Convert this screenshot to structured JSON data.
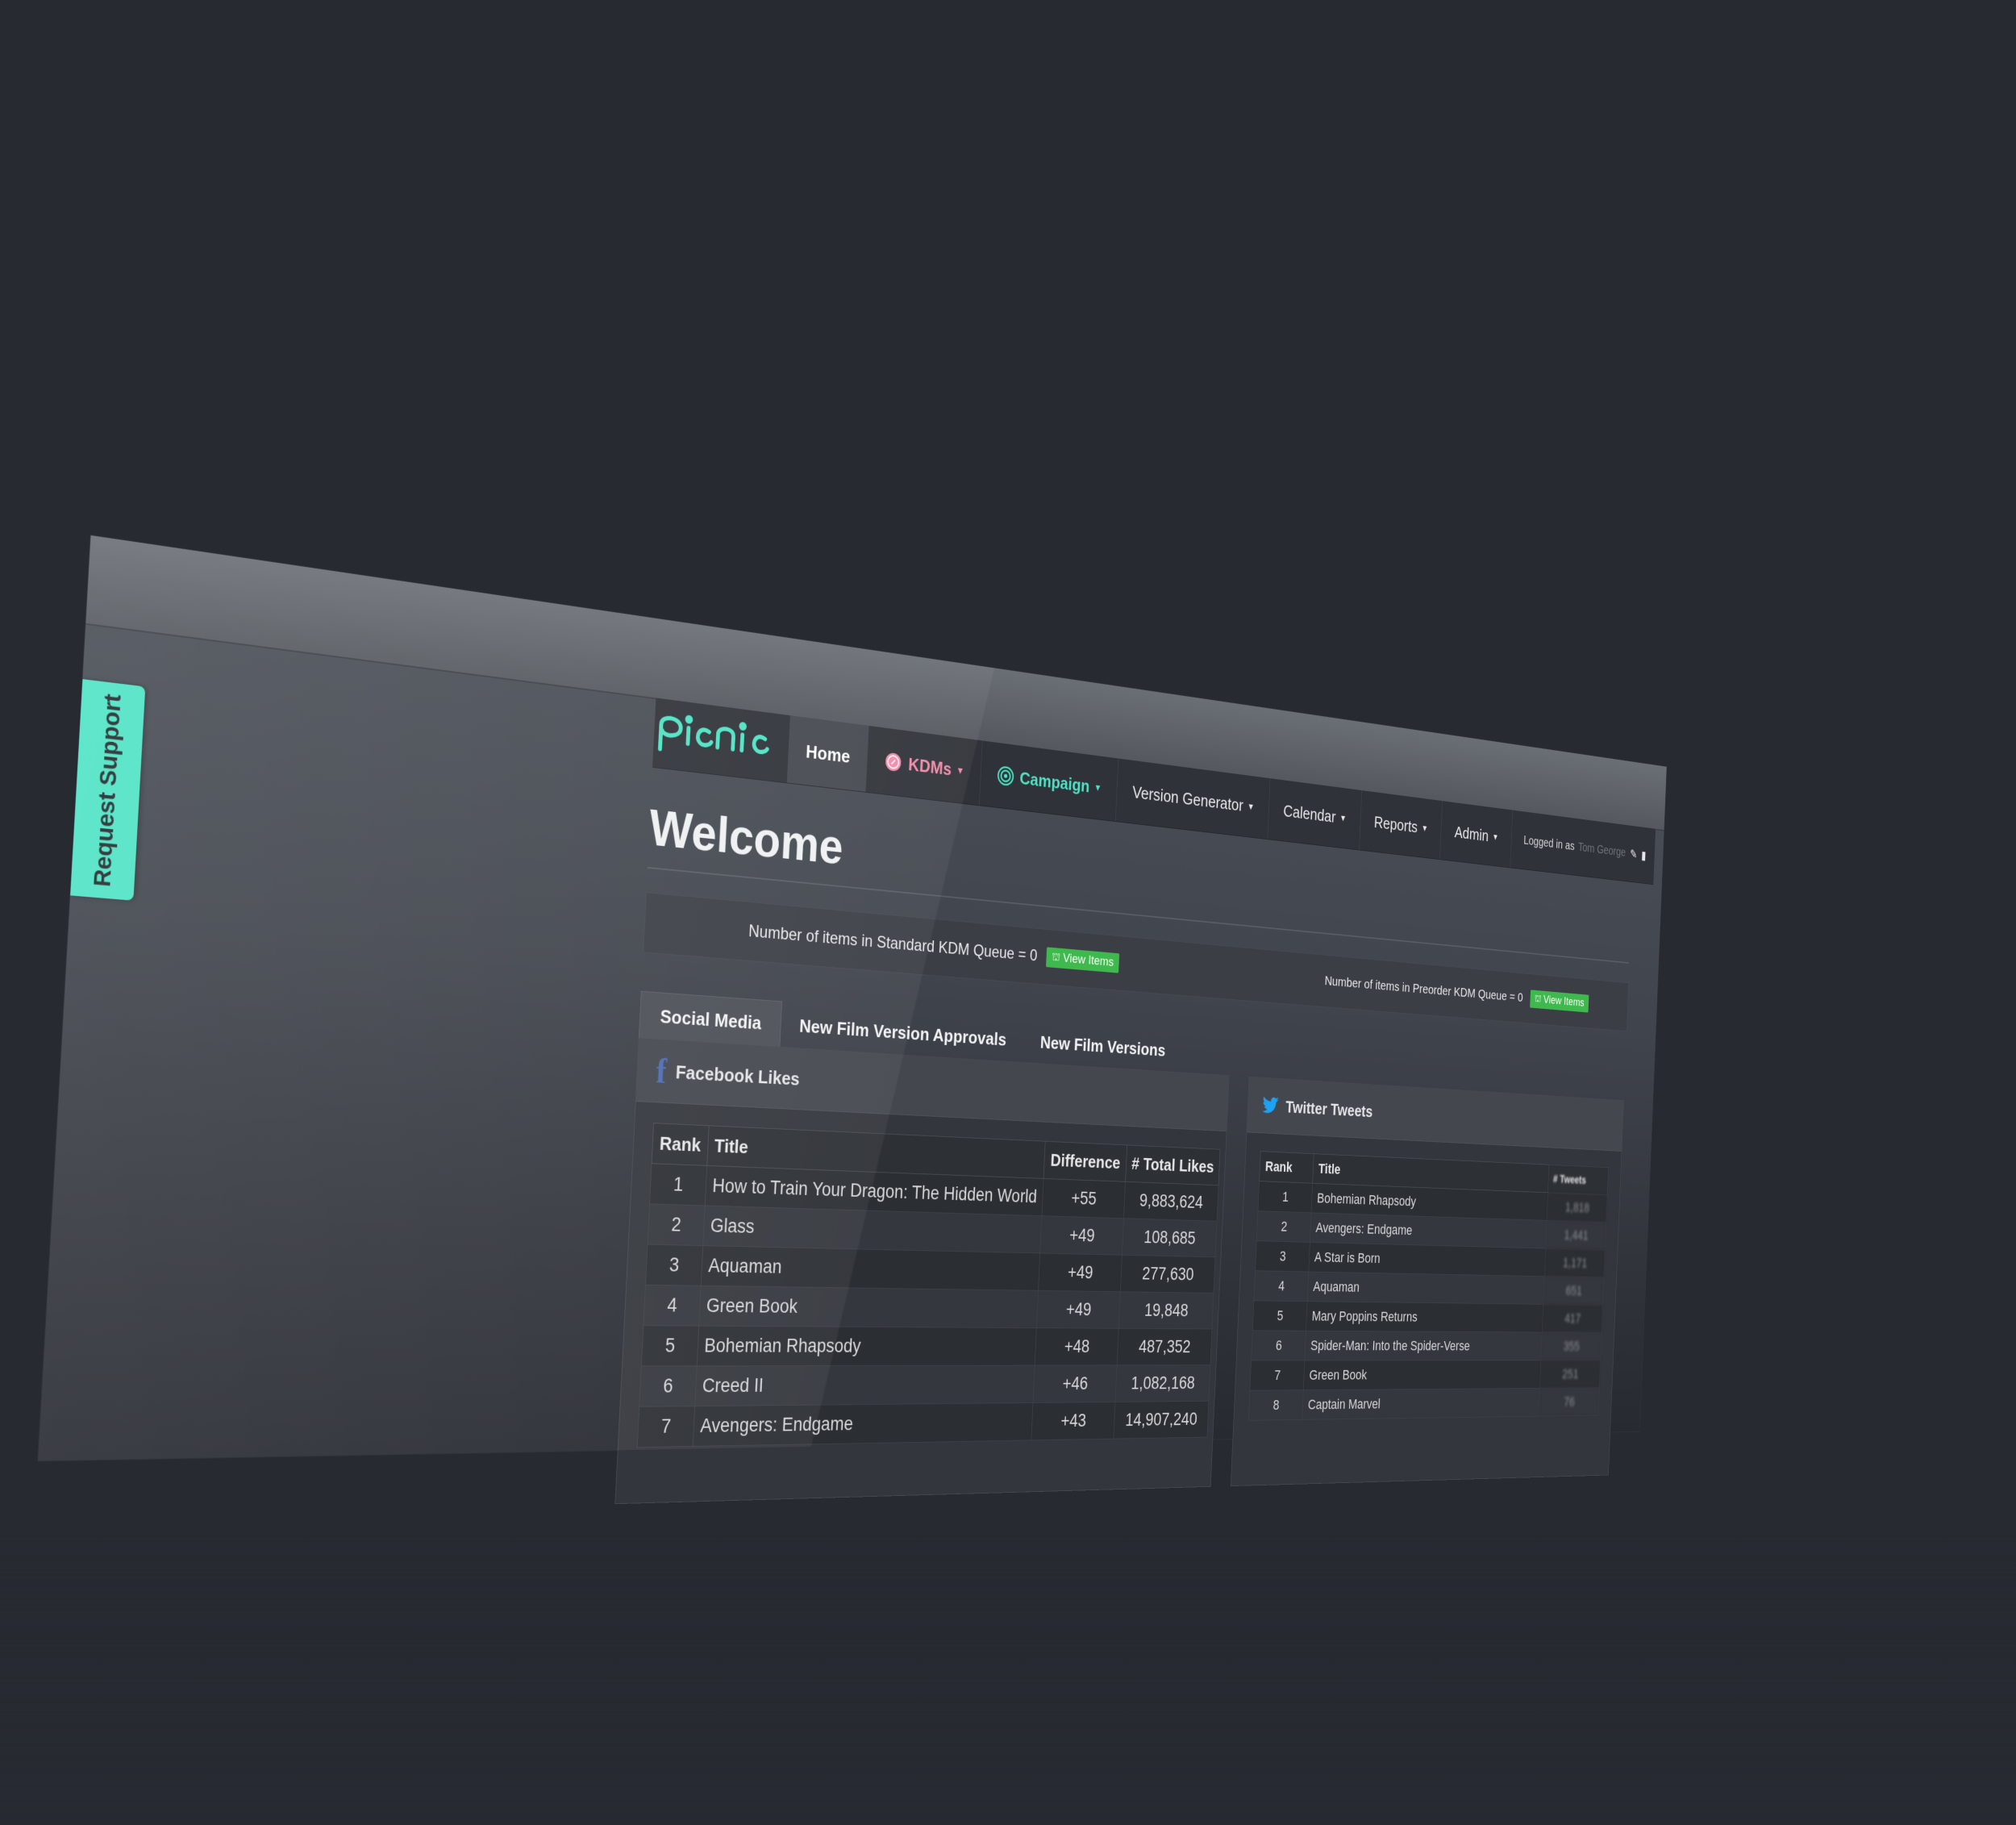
{
  "support_tab": {
    "label": "Request Support"
  },
  "nav": {
    "logo": "picnic",
    "items": [
      {
        "label": "Home",
        "active": true,
        "dropdown": false
      },
      {
        "label": "KDMs",
        "dropdown": true
      },
      {
        "label": "Campaign",
        "dropdown": true
      },
      {
        "label": "Version Generator",
        "dropdown": true
      },
      {
        "label": "Calendar",
        "dropdown": true
      },
      {
        "label": "Reports",
        "dropdown": true
      },
      {
        "label": "Admin",
        "dropdown": true
      }
    ],
    "logged_in_label": "Logged in as",
    "logged_in_user": "Tom George"
  },
  "page": {
    "title": "Welcome"
  },
  "queues": {
    "standard_label": "Number of items in Standard KDM Queue = 0",
    "preorder_label": "Number of items in Preorder KDM Queue = 0",
    "view_button": "View Items"
  },
  "tabs": [
    "Social Media",
    "New Film Version Approvals",
    "New Film Versions"
  ],
  "facebook": {
    "title": "Facebook Likes",
    "columns": [
      "Rank",
      "Title",
      "Difference",
      "# Total Likes"
    ],
    "rows": [
      {
        "rank": "1",
        "title": "How to Train Your Dragon: The Hidden World",
        "difference": "+55",
        "total": "9,883,624"
      },
      {
        "rank": "2",
        "title": "Glass",
        "difference": "+49",
        "total": "108,685"
      },
      {
        "rank": "3",
        "title": "Aquaman",
        "difference": "+49",
        "total": "277,630"
      },
      {
        "rank": "4",
        "title": "Green Book",
        "difference": "+49",
        "total": "19,848"
      },
      {
        "rank": "5",
        "title": "Bohemian Rhapsody",
        "difference": "+48",
        "total": "487,352"
      },
      {
        "rank": "6",
        "title": "Creed II",
        "difference": "+46",
        "total": "1,082,168"
      },
      {
        "rank": "7",
        "title": "Avengers: Endgame",
        "difference": "+43",
        "total": "14,907,240"
      }
    ]
  },
  "twitter": {
    "title": "Twitter Tweets",
    "columns": [
      "Rank",
      "Title",
      "# Tweets"
    ],
    "rows": [
      {
        "rank": "1",
        "title": "Bohemian Rhapsody",
        "tweets": "1,818"
      },
      {
        "rank": "2",
        "title": "Avengers: Endgame",
        "tweets": "1,441"
      },
      {
        "rank": "3",
        "title": "A Star is Born",
        "tweets": "1,171"
      },
      {
        "rank": "4",
        "title": "Aquaman",
        "tweets": "651"
      },
      {
        "rank": "5",
        "title": "Mary Poppins Returns",
        "tweets": "417"
      },
      {
        "rank": "6",
        "title": "Spider-Man: Into the Spider-Verse",
        "tweets": "355"
      },
      {
        "rank": "7",
        "title": "Green Book",
        "tweets": "251"
      },
      {
        "rank": "8",
        "title": "Captain Marvel",
        "tweets": "76"
      }
    ]
  },
  "colors": {
    "background": "#272a31",
    "accent_teal": "#4ee3c4",
    "kdm_pink": "#f28aa8",
    "view_green": "#3fb94d",
    "facebook_blue": "#4a6cb3",
    "twitter_blue": "#1da1f2"
  }
}
